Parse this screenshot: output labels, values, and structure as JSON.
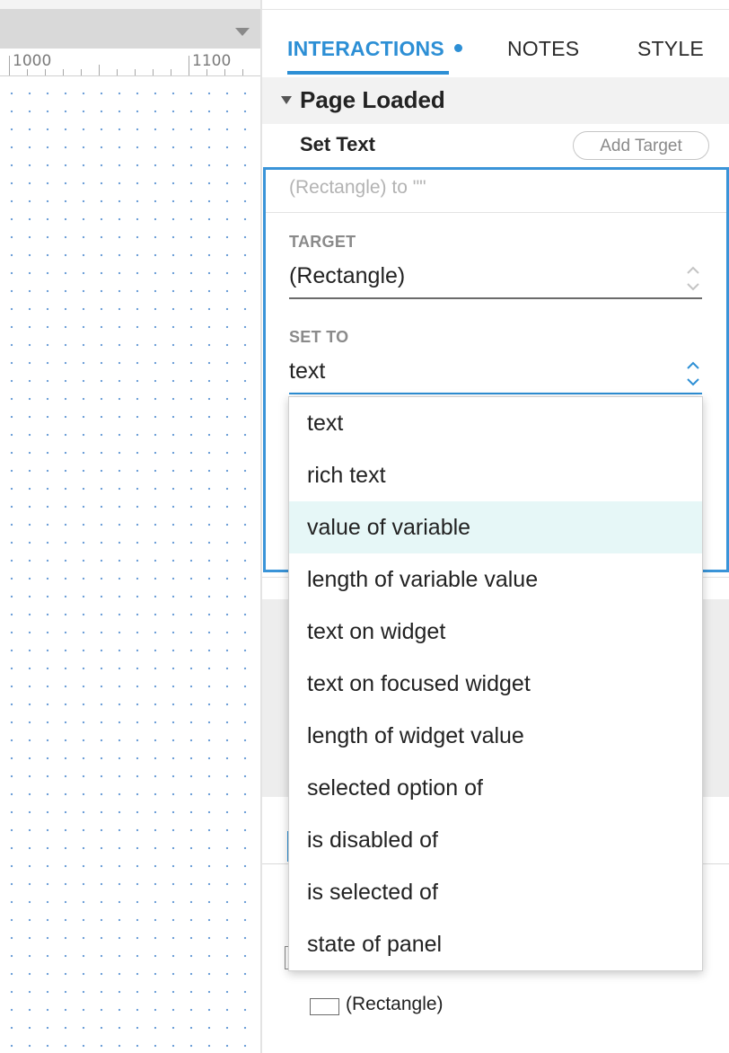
{
  "ruler": {
    "labels": [
      "1000",
      "1100"
    ]
  },
  "tabs": [
    {
      "label": "INTERACTIONS",
      "active": true,
      "has_dot": true
    },
    {
      "label": "NOTES",
      "active": false
    },
    {
      "label": "STYLE",
      "active": false
    }
  ],
  "event": {
    "title": "Page Loaded",
    "expanded": true
  },
  "action": {
    "title": "Set Text",
    "add_target_label": "Add Target",
    "summary": "(Rectangle) to \"\"",
    "target_label": "TARGET",
    "target_value": "(Rectangle)",
    "set_to_label": "SET TO",
    "set_to_value": "text"
  },
  "dropdown": {
    "hovered": "value of variable",
    "options": [
      "text",
      "rich text",
      "value of variable",
      "length of variable value",
      "text on widget",
      "text on focused widget",
      "length of widget value",
      "selected option of",
      "is disabled of",
      "is selected of",
      "state of panel"
    ]
  },
  "lower": {
    "item_label": "(Rectangle)"
  },
  "colors": {
    "accent": "#2d8fd5",
    "hover_row": "#e6f7f7",
    "grid_dot": "#6fa0d8",
    "toolbar_gray": "#d9d9d9"
  },
  "icons": [
    "chevron-down-icon",
    "caret-down-icon",
    "up-down-chevron-icon",
    "rectangle-icon"
  ]
}
